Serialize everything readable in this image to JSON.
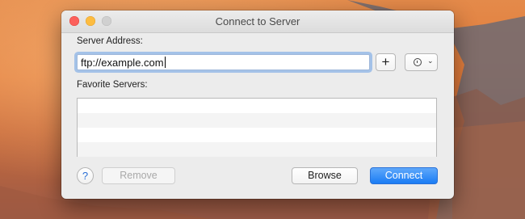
{
  "window": {
    "title": "Connect to Server"
  },
  "server_address": {
    "label": "Server Address:",
    "value": "ftp://example.com"
  },
  "favorites": {
    "label": "Favorite Servers:",
    "items": []
  },
  "buttons": {
    "add": "+",
    "recent_icon": "clock-icon",
    "help": "?",
    "remove": "Remove",
    "browse": "Browse",
    "connect": "Connect"
  },
  "colors": {
    "accent": "#1a7cf4",
    "close": "#fc605c",
    "minimize": "#fdbc40",
    "zoom_disabled": "#d0d0d0"
  }
}
